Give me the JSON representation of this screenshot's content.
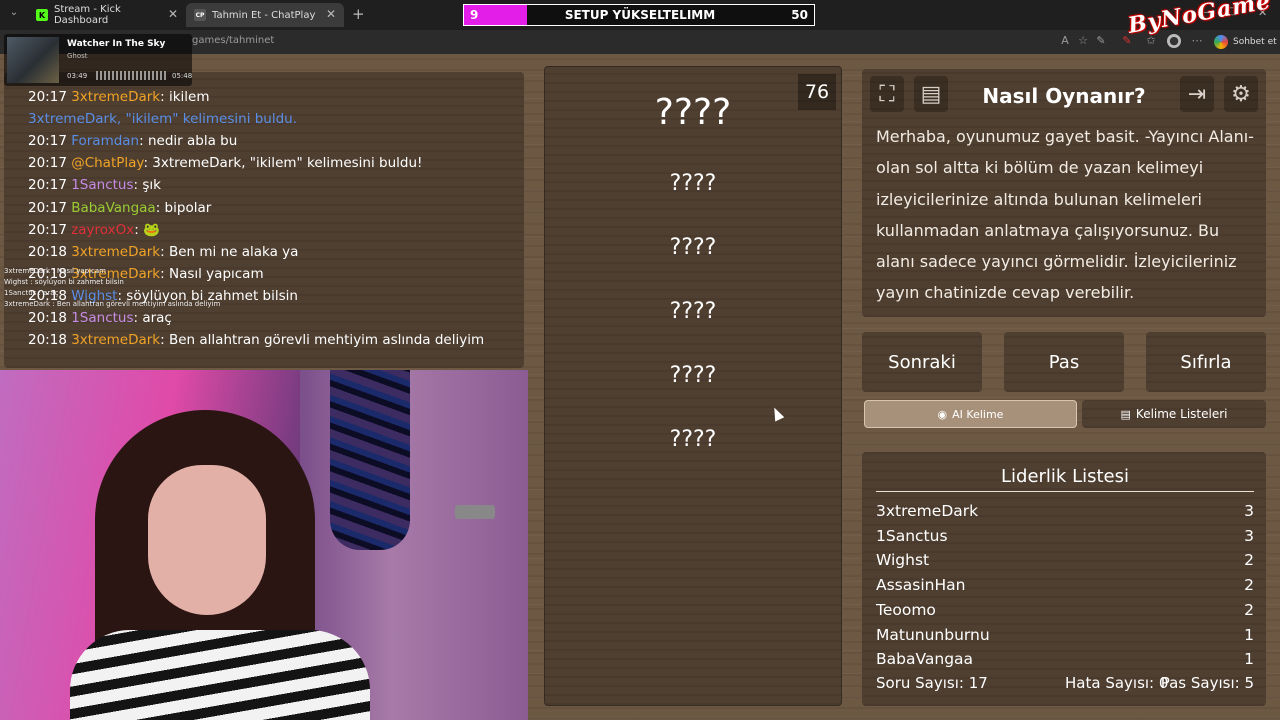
{
  "browser": {
    "tabs": [
      {
        "label": "Stream - Kick Dashboard",
        "icon": "K"
      },
      {
        "label": "Tahmin Et - ChatPlay",
        "icon": "CP"
      }
    ],
    "url_fragment": "games/tahminet",
    "profile_button": "Sohbet et"
  },
  "overlay": {
    "goal_current": "9",
    "goal_title": "SETUP YÜKSELTELIMM",
    "goal_target": "50",
    "goal_progress": 0.18,
    "logo_text": "ByNoGame"
  },
  "music": {
    "title": "Watcher In The Sky",
    "artist": "Ghost",
    "elapsed": "03:49",
    "duration": "05:48"
  },
  "chat": [
    {
      "time": "20:17",
      "user": "3xtremeDark",
      "color": "orange",
      "text": ": ikilem"
    },
    {
      "time": "",
      "user": "3xtremeDark, ",
      "color": "blue",
      "text": "\"ikilem\" kelimesini buldu."
    },
    {
      "time": "20:17",
      "user": "Foramdan",
      "color": "blue",
      "text": ": nedir abla bu"
    },
    {
      "time": "20:17",
      "user": "@ChatPlay",
      "color": "orange",
      "text": ": 3xtremeDark, \"ikilem\" kelimesini buldu!"
    },
    {
      "time": "20:17",
      "user": "1Sanctus",
      "color": "pink",
      "text": ": şık"
    },
    {
      "time": "20:17",
      "user": "BabaVangaa",
      "color": "lime",
      "text": ": bipolar"
    },
    {
      "time": "20:17",
      "user": "zayroxOx",
      "color": "red",
      "text": ": 🐸"
    },
    {
      "time": "20:18",
      "user": "3xtremeDark",
      "color": "orange",
      "text": ": Ben mi ne alaka ya"
    },
    {
      "time": "20:18",
      "user": "3xtremeDark",
      "color": "orange",
      "text": ": Nasıl yapıcam"
    },
    {
      "time": "20:18",
      "user": "Wighst",
      "color": "blue",
      "text": ": söylüyon bi zahmet bilsin"
    },
    {
      "time": "20:18",
      "user": "1Sanctus",
      "color": "pink",
      "text": ": araç"
    },
    {
      "time": "20:18",
      "user": "3xtremeDark",
      "color": "orange",
      "text": ": Ben allahtran görevli mehtiyim aslında deliyim"
    }
  ],
  "ghost_chat": [
    "3xtremeDark : Nasıl yapıcam",
    "Wighst : söylüyon bi zahmet bilsin",
    "1Sanctus : araç",
    "3xtremeDark : Ben allahtran görevli mehtiyim aslında deliyim"
  ],
  "game": {
    "timer": "76",
    "words": [
      "????",
      "????",
      "????",
      "????",
      "????",
      "????"
    ],
    "howto_title": "Nasıl Oynanır?",
    "howto_text": "Merhaba, oyunumuz gayet basit. -Yayıncı Alanı- olan sol altta ki bölüm de yazan kelimeyi izleyicilerinize altında bulunan kelimeleri kullanmadan anlatmaya çalışıyorsunuz. Bu alanı sadece yayıncı görmelidir. İzleyicileriniz yayın chatinizde cevap verebilir.",
    "buttons": {
      "next": "Sonraki",
      "pass": "Pas",
      "reset": "Sıfırla"
    },
    "ai_word": "AI Kelime",
    "word_lists": "Kelime Listeleri",
    "leaderboard_title": "Liderlik Listesi",
    "leaderboard": [
      {
        "name": "3xtremeDark",
        "score": "3"
      },
      {
        "name": "1Sanctus",
        "score": "3"
      },
      {
        "name": "Wighst",
        "score": "2"
      },
      {
        "name": "AssasinHan",
        "score": "2"
      },
      {
        "name": "Teoomo",
        "score": "2"
      },
      {
        "name": "Matununburnu",
        "score": "1"
      },
      {
        "name": "BabaVangaa",
        "score": "1"
      }
    ],
    "stats": {
      "questions": "Soru Sayısı: 17",
      "errors": "Hata Sayısı: 0",
      "passes": "Pas Sayısı: 5"
    }
  },
  "colors": {
    "orange": "#f0a326",
    "blue": "#5a8ee6",
    "pink": "#c58be6",
    "lime": "#9acd32",
    "red": "#e0303a",
    "goal_fill": "#e21ee8"
  }
}
